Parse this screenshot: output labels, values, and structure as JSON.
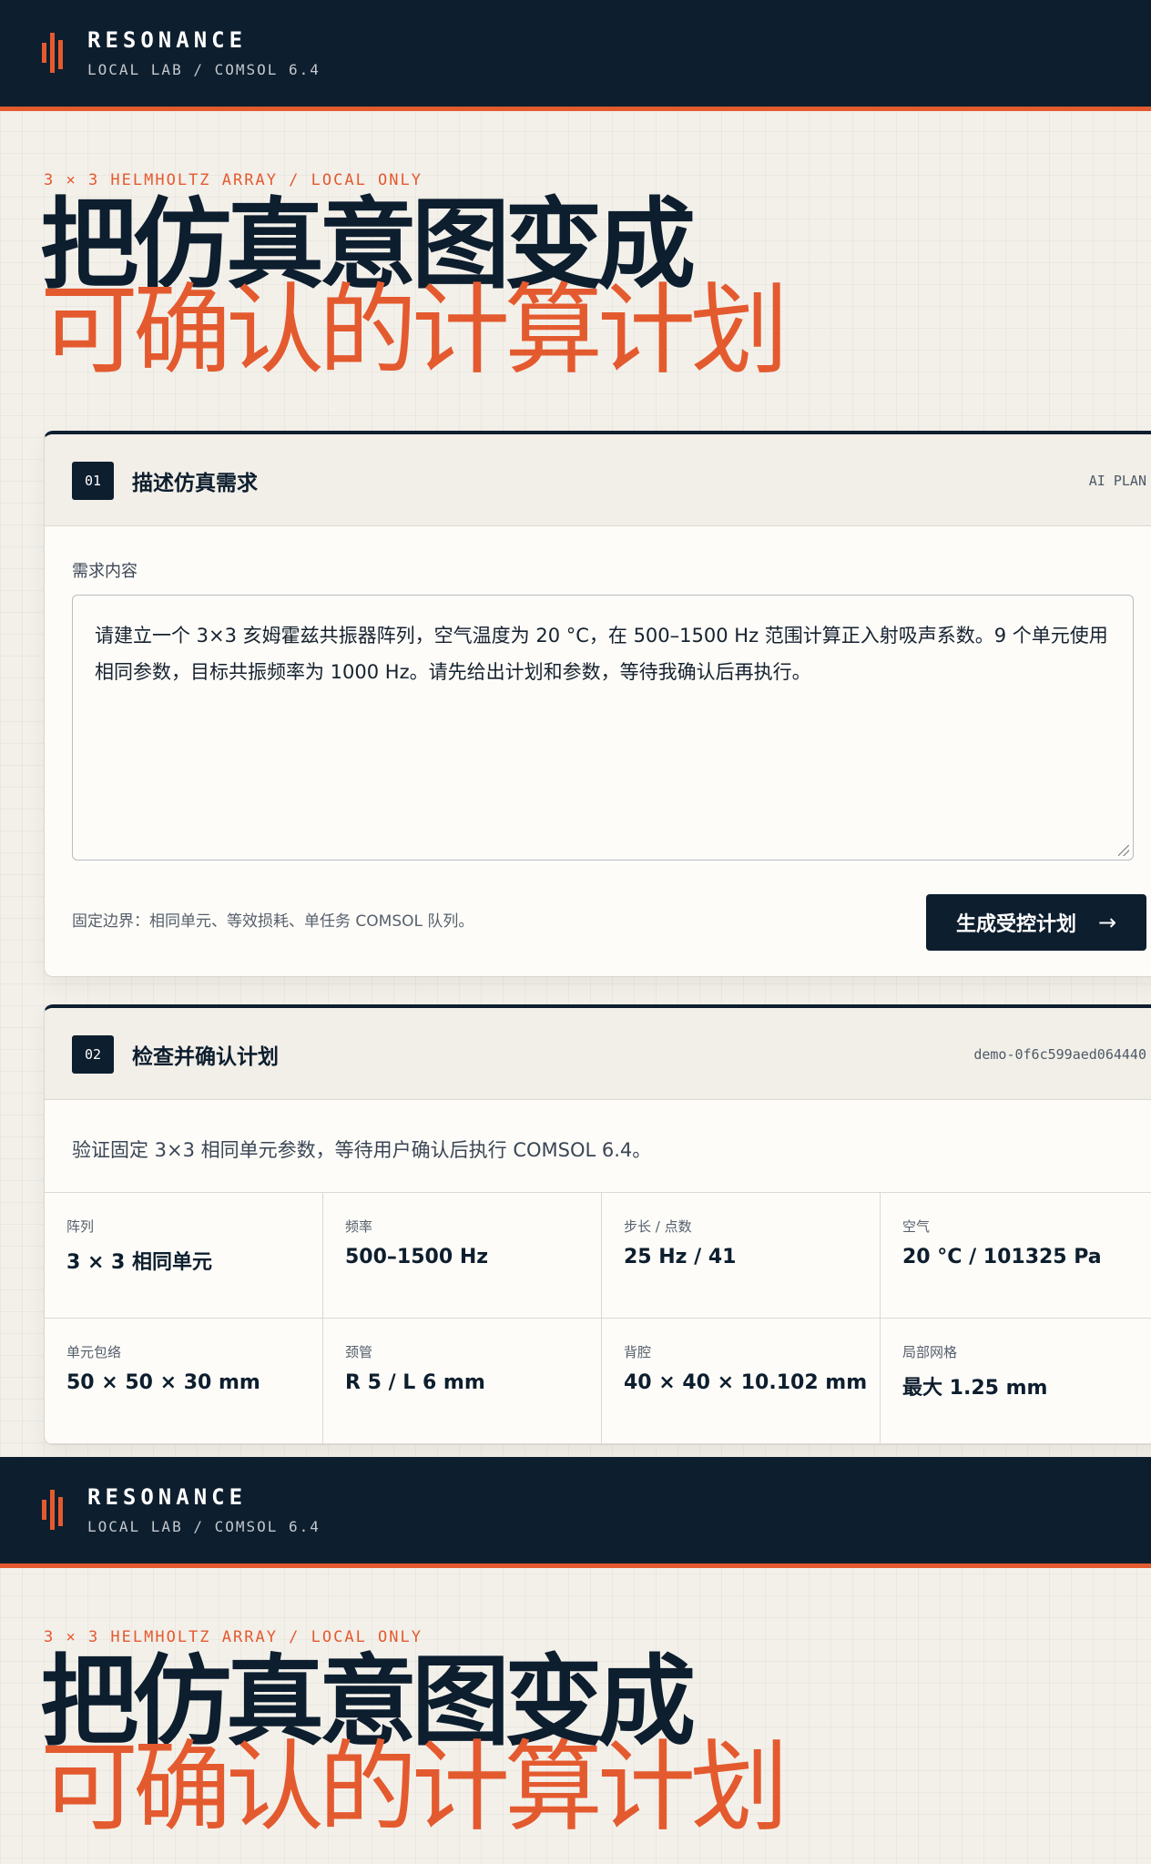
{
  "brand": {
    "name": "RESONANCE",
    "subtitle": "LOCAL LAB / COMSOL 6.4"
  },
  "hero": {
    "eyebrow": "3 × 3 HELMHOLTZ ARRAY / LOCAL ONLY",
    "line1": "把仿真意图变成",
    "line2": "可确认的计算计划"
  },
  "step1": {
    "number": "01",
    "title": "描述仿真需求",
    "tag": "AI PLAN",
    "field_label": "需求内容",
    "textarea_value": "请建立一个 3×3 亥姆霍兹共振器阵列，空气温度为 20 °C，在 500–1500 Hz 范围计算正入射吸声系数。9 个单元使用相同参数，目标共振频率为 1000 Hz。请先给出计划和参数，等待我确认后再执行。",
    "footnote": "固定边界：相同单元、等效损耗、单任务 COMSOL 队列。",
    "button_label": "生成受控计划",
    "button_icon": "arrow-right-icon"
  },
  "step2": {
    "number": "02",
    "title": "检查并确认计划",
    "plan_id": "demo-0f6c599aed064440",
    "summary": "验证固定 3×3 相同单元参数，等待用户确认后执行 COMSOL 6.4。",
    "params": [
      {
        "key": "阵列",
        "value": "3 × 3 相同单元"
      },
      {
        "key": "频率",
        "value": "500–1500 Hz"
      },
      {
        "key": "步长 / 点数",
        "value": "25 Hz / 41"
      },
      {
        "key": "空气",
        "value": "20 °C / 101325 Pa"
      },
      {
        "key": "单元包络",
        "value": "50 × 50 × 30 mm"
      },
      {
        "key": "颈管",
        "value": "R 5 / L 6 mm"
      },
      {
        "key": "背腔",
        "value": "40 × 40 × 10.102 mm"
      },
      {
        "key": "局部网格",
        "value": "最大 1.25 mm"
      }
    ]
  },
  "colors": {
    "navy": "#0d1e2e",
    "accent": "#e45a2f",
    "paper": "#f3f0ea"
  }
}
